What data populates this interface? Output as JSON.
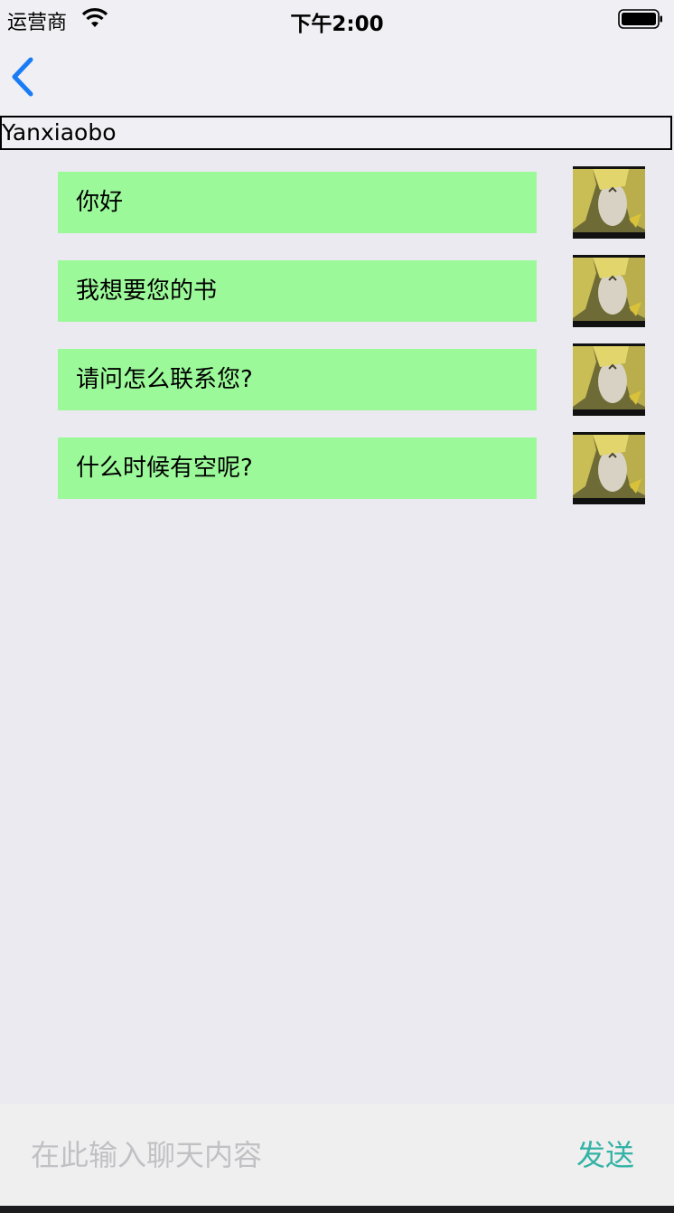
{
  "status_bar": {
    "carrier": "运营商",
    "time": "下午2:00",
    "wifi_icon": "wifi-icon",
    "battery_icon": "battery-icon"
  },
  "nav": {
    "back_icon": "chevron-left-icon",
    "accent_color": "#1a7cf5"
  },
  "chat": {
    "contact_name": "Yanxiaobo",
    "bubble_color": "#9cf99a",
    "messages": [
      {
        "text": "你好",
        "avatar": "avatar-image"
      },
      {
        "text": "我想要您的书",
        "avatar": "avatar-image"
      },
      {
        "text": "请问怎么联系您?",
        "avatar": "avatar-image"
      },
      {
        "text": "什么时候有空呢?",
        "avatar": "avatar-image"
      }
    ]
  },
  "composer": {
    "placeholder": "在此输入聊天内容",
    "value": "",
    "send_label": "发送",
    "send_color": "#34b3a6"
  }
}
